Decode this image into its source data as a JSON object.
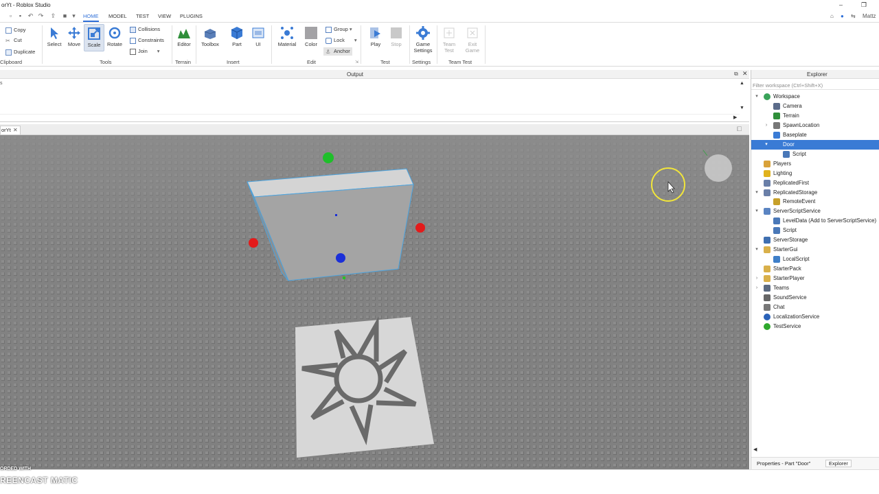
{
  "window": {
    "title": "orYt - Roblox Studio",
    "minimize": "–",
    "maximize": "❐"
  },
  "tabs": [
    {
      "label": "HOME",
      "active": true
    },
    {
      "label": "MODEL",
      "active": false
    },
    {
      "label": "TEST",
      "active": false
    },
    {
      "label": "VIEW",
      "active": false
    },
    {
      "label": "PLUGINS",
      "active": false
    }
  ],
  "user": {
    "name": "Mattz"
  },
  "ribbon": {
    "clipboard": {
      "copy": "Copy",
      "cut": "Cut",
      "duplicate": "Duplicate",
      "group_label": "Clipboard"
    },
    "tools": {
      "select": "Select",
      "move": "Move",
      "scale": "Scale",
      "rotate": "Rotate",
      "collisions": "Collisions",
      "constraints": "Constraints",
      "join": "Join",
      "group_label": "Tools"
    },
    "terrain": {
      "editor": "Editor",
      "group_label": "Terrain"
    },
    "insert": {
      "toolbox": "Toolbox",
      "part": "Part",
      "ui": "UI",
      "group_label": "Insert"
    },
    "edit": {
      "material": "Material",
      "color": "Color",
      "group": "Group",
      "lock": "Lock",
      "anchor": "Anchor",
      "group_label": "Edit"
    },
    "test": {
      "play": "Play",
      "stop": "Stop",
      "group_label": "Test"
    },
    "settings": {
      "game_settings_1": "Game",
      "game_settings_2": "Settings",
      "group_label": "Settings"
    },
    "team_test": {
      "team_test_1": "Team",
      "team_test_2": "Test",
      "exit_game_1": "Exit",
      "exit_game_2": "Game",
      "group_label": "Team Test"
    }
  },
  "output": {
    "title": "Output",
    "first_char": "s"
  },
  "document_tab": {
    "label": "orYt"
  },
  "explorer": {
    "title": "Explorer",
    "filter_placeholder": "Filter workspace (Ctrl+Shift+X)",
    "nodes": [
      {
        "label": "Workspace",
        "icon": "globe",
        "arrow": "▾"
      },
      {
        "label": "Camera",
        "icon": "camera",
        "arrow": ""
      },
      {
        "label": "Terrain",
        "icon": "terrain",
        "arrow": ""
      },
      {
        "label": "SpawnLocation",
        "icon": "spawn",
        "arrow": "›"
      },
      {
        "label": "Baseplate",
        "icon": "part",
        "arrow": ""
      },
      {
        "label": "Door",
        "icon": "part",
        "arrow": "▾",
        "selected": true
      },
      {
        "label": "Script",
        "icon": "script",
        "arrow": ""
      },
      {
        "label": "Players",
        "icon": "players",
        "arrow": ""
      },
      {
        "label": "Lighting",
        "icon": "lighting",
        "arrow": ""
      },
      {
        "label": "ReplicatedFirst",
        "icon": "service",
        "arrow": ""
      },
      {
        "label": "ReplicatedStorage",
        "icon": "service",
        "arrow": "▾"
      },
      {
        "label": "RemoteEvent",
        "icon": "remote",
        "arrow": ""
      },
      {
        "label": "ServerScriptService",
        "icon": "server-script",
        "arrow": "▾"
      },
      {
        "label": "LevelData (Add to ServerScriptService)",
        "icon": "script",
        "arrow": ""
      },
      {
        "label": "Script",
        "icon": "script",
        "arrow": ""
      },
      {
        "label": "ServerStorage",
        "icon": "server-storage",
        "arrow": ""
      },
      {
        "label": "StarterGui",
        "icon": "folder",
        "arrow": "▾"
      },
      {
        "label": "LocalScript",
        "icon": "local-script",
        "arrow": ""
      },
      {
        "label": "StarterPack",
        "icon": "folder",
        "arrow": ""
      },
      {
        "label": "StarterPlayer",
        "icon": "folder",
        "arrow": "›"
      },
      {
        "label": "Teams",
        "icon": "teams",
        "arrow": "›"
      },
      {
        "label": "SoundService",
        "icon": "sound",
        "arrow": ""
      },
      {
        "label": "Chat",
        "icon": "chat",
        "arrow": ""
      },
      {
        "label": "LocalizationService",
        "icon": "localization",
        "arrow": ""
      },
      {
        "label": "TestService",
        "icon": "test",
        "arrow": ""
      }
    ],
    "footer_tabs": [
      "Properties - Part \"Door\"",
      "Explorer"
    ]
  },
  "watermark": {
    "line1": "ORDED WITH",
    "line2": "REENCAST MATIC"
  },
  "colors": {
    "accent": "#2e6fd8",
    "selection": "#3a7bd5",
    "baseplate": "#7d7d7d"
  }
}
